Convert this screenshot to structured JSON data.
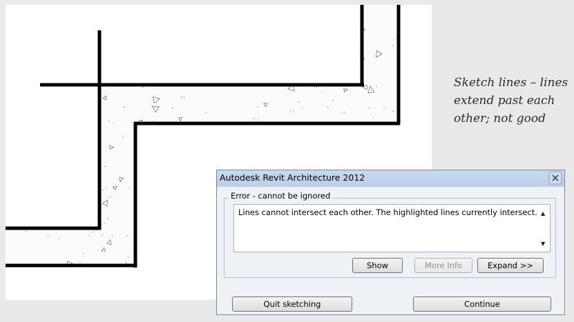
{
  "caption": {
    "line1": "Sketch lines – lines",
    "line2": "extend past each",
    "line3": "other; not good"
  },
  "dialog": {
    "title": "Autodesk Revit Architecture 2012",
    "group_label": "Error - cannot be ignored",
    "message": "Lines cannot intersect each other. The highlighted lines currently intersect.",
    "buttons": {
      "show": "Show",
      "more_info": "More Info",
      "expand": "Expand >>",
      "quit": "Quit sketching",
      "continue": "Continue"
    },
    "icons": {
      "close": "close-icon",
      "scroll_up": "scroll-up-arrow-icon",
      "scroll_down": "scroll-down-arrow-icon"
    }
  },
  "colors": {
    "sketch_line": "#000000",
    "concrete_hatch": "#666666",
    "canvas": "#ffffff",
    "background": "#e9e9e9",
    "dialog_title": "#c4d5ec"
  }
}
